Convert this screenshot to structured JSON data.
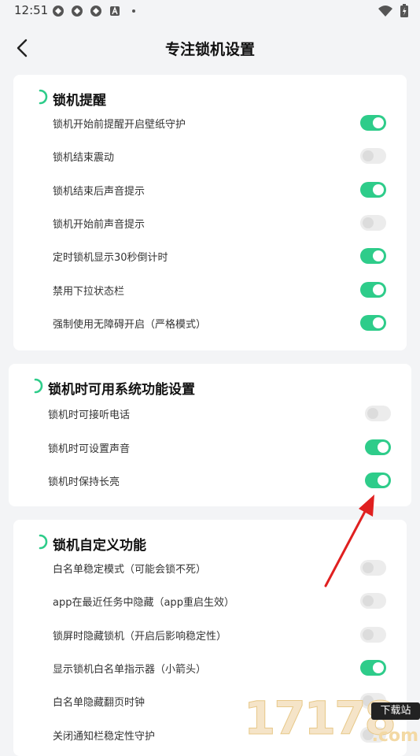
{
  "status_bar": {
    "time": "12:51"
  },
  "header": {
    "title": "专注锁机设置"
  },
  "sections": [
    {
      "title": "锁机提醒",
      "items": [
        {
          "label": "锁机开始前提醒开启壁纸守护",
          "on": true
        },
        {
          "label": "锁机结束震动",
          "on": false
        },
        {
          "label": "锁机结束后声音提示",
          "on": true
        },
        {
          "label": "锁机开始前声音提示",
          "on": false
        },
        {
          "label": "定时锁机显示30秒倒计时",
          "on": true
        },
        {
          "label": "禁用下拉状态栏",
          "on": true
        },
        {
          "label": "强制使用无障碍开启（严格模式）",
          "on": true
        }
      ]
    },
    {
      "title": "锁机时可用系统功能设置",
      "items": [
        {
          "label": "锁机时可接听电话",
          "on": false
        },
        {
          "label": "锁机时可设置声音",
          "on": true
        },
        {
          "label": "锁机时保持长亮",
          "on": true
        }
      ]
    },
    {
      "title": "锁机自定义功能",
      "items": [
        {
          "label": "白名单稳定模式（可能会锁不死）",
          "on": false
        },
        {
          "label": "app在最近任务中隐藏（app重启生效）",
          "on": false
        },
        {
          "label": "锁屏时隐藏锁机（开启后影响稳定性）",
          "on": false
        },
        {
          "label": "显示锁机白名单指示器（小箭头）",
          "on": true
        },
        {
          "label": "白名单隐藏翻页时钟",
          "on": false
        },
        {
          "label": "关闭通知栏稳定性守护",
          "on": false
        }
      ]
    }
  ],
  "watermark": {
    "digits": "17178",
    "badge": "下载站",
    "suffix": ".com"
  },
  "colors": {
    "toggle_on": "#2ecc8a",
    "toggle_off": "#ececec",
    "accent": "#2ecc8a",
    "arrow": "#e02020"
  }
}
